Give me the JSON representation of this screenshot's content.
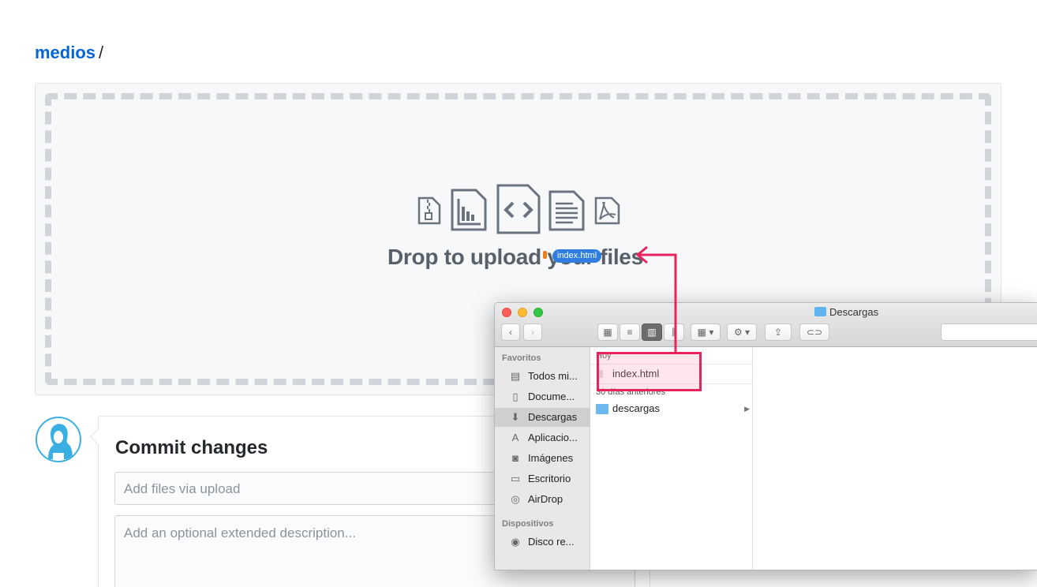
{
  "breadcrumb": {
    "repo": "medios",
    "separator": "/"
  },
  "dropzone": {
    "message": "Drop to upload your files",
    "drag_badge": "index.html",
    "icons": [
      "zip-file-icon",
      "chart-file-icon",
      "code-file-icon",
      "text-file-icon",
      "pdf-file-icon"
    ]
  },
  "commit": {
    "title": "Commit changes",
    "summary_placeholder": "Add files via upload",
    "description_placeholder": "Add an optional extended description..."
  },
  "finder": {
    "title": "Descargas",
    "sidebar": {
      "favorites_header": "Favoritos",
      "items": [
        {
          "label": "Todos mi...",
          "icon": "all-files-icon"
        },
        {
          "label": "Docume...",
          "icon": "documents-icon"
        },
        {
          "label": "Descargas",
          "icon": "downloads-icon",
          "selected": true
        },
        {
          "label": "Aplicacio...",
          "icon": "applications-icon"
        },
        {
          "label": "Imágenes",
          "icon": "camera-icon"
        },
        {
          "label": "Escritorio",
          "icon": "desktop-icon"
        },
        {
          "label": "AirDrop",
          "icon": "airdrop-icon"
        }
      ],
      "devices_header": "Dispositivos",
      "devices": [
        {
          "label": "Disco re...",
          "icon": "disk-icon"
        }
      ]
    },
    "column": {
      "group_today": "Hoy",
      "files_today": [
        {
          "name": "index.html",
          "icon": "html-file-icon"
        }
      ],
      "group_older": "30 días anteriores",
      "files_older": [
        {
          "name": "descargas",
          "icon": "folder-icon",
          "has_children": true
        }
      ]
    }
  },
  "colors": {
    "link": "#0366d6",
    "highlight": "#e8245f",
    "avatar_border": "#3ab0e2",
    "drag_badge": "#2f7de1"
  }
}
